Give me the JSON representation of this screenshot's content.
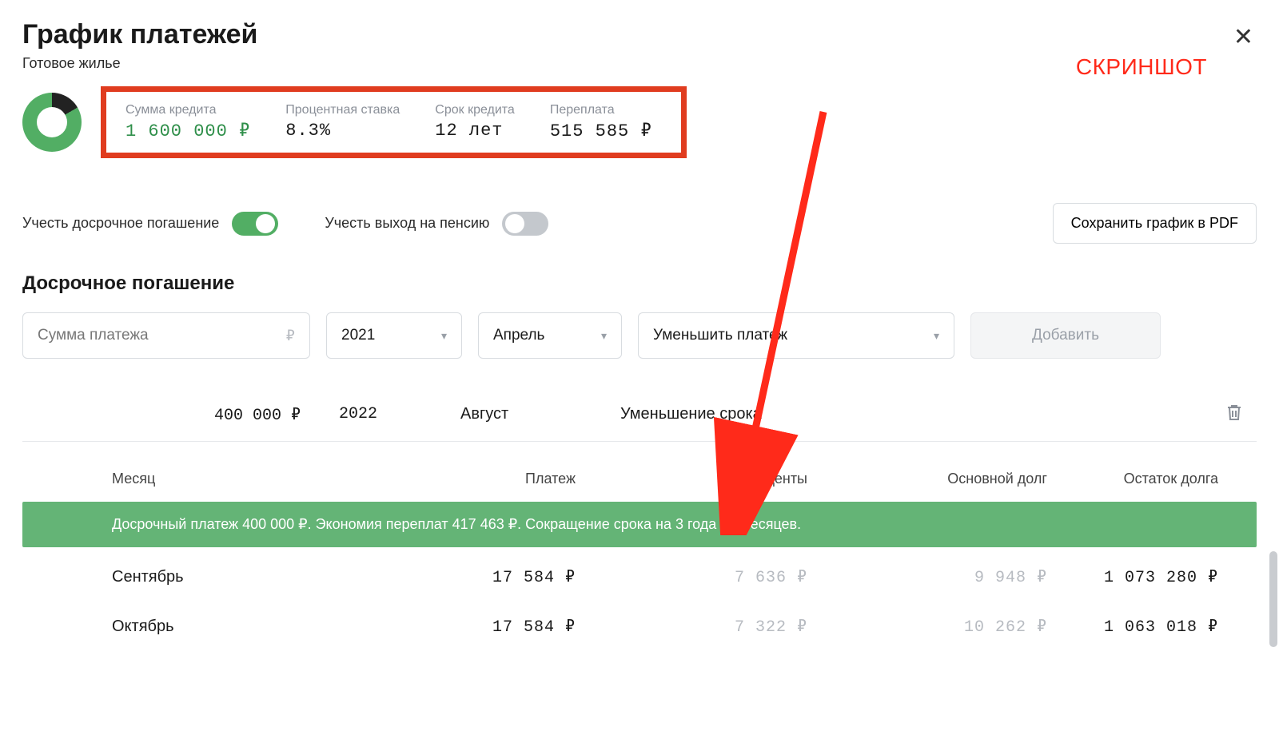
{
  "annotation": {
    "label": "СКРИНШОТ"
  },
  "header": {
    "title": "График платежей",
    "subtitle": "Готовое жилье"
  },
  "summary": {
    "loan_amount": {
      "label": "Сумма кредита",
      "value": "1 600 000 ₽"
    },
    "rate": {
      "label": "Процентная ставка",
      "value": "8.3%"
    },
    "term": {
      "label": "Срок кредита",
      "value": "12 лет"
    },
    "overpay": {
      "label": "Переплата",
      "value": "515 585 ₽"
    }
  },
  "toggles": {
    "early_repay_label": "Учесть досрочное погашение",
    "pension_label": "Учесть выход на пенсию",
    "pdf_button": "Сохранить график в PDF"
  },
  "prepay_form": {
    "section_title": "Досрочное погашение",
    "amount_placeholder": "Сумма платежа",
    "ruble": "₽",
    "year": "2021",
    "month": "Апрель",
    "type": "Уменьшить платеж",
    "add_button": "Добавить"
  },
  "prepay_existing": {
    "amount": "400 000 ₽",
    "year": "2022",
    "month": "Август",
    "type": "Уменьшение срока"
  },
  "table": {
    "headers": {
      "month": "Месяц",
      "payment": "Платеж",
      "interest": "Проценты",
      "principal": "Основной долг",
      "balance": "Остаток долга"
    },
    "banner": "Досрочный платеж 400 000 ₽. Экономия переплат 417 463 ₽. Сокращение срока на 3 года 10 месяцев.",
    "rows": [
      {
        "month": "Сентябрь",
        "payment": "17 584 ₽",
        "interest": "7 636 ₽",
        "principal": "9 948 ₽",
        "balance": "1 073 280 ₽"
      },
      {
        "month": "Октябрь",
        "payment": "17 584 ₽",
        "interest": "7 322 ₽",
        "principal": "10 262 ₽",
        "balance": "1 063 018 ₽"
      }
    ]
  }
}
